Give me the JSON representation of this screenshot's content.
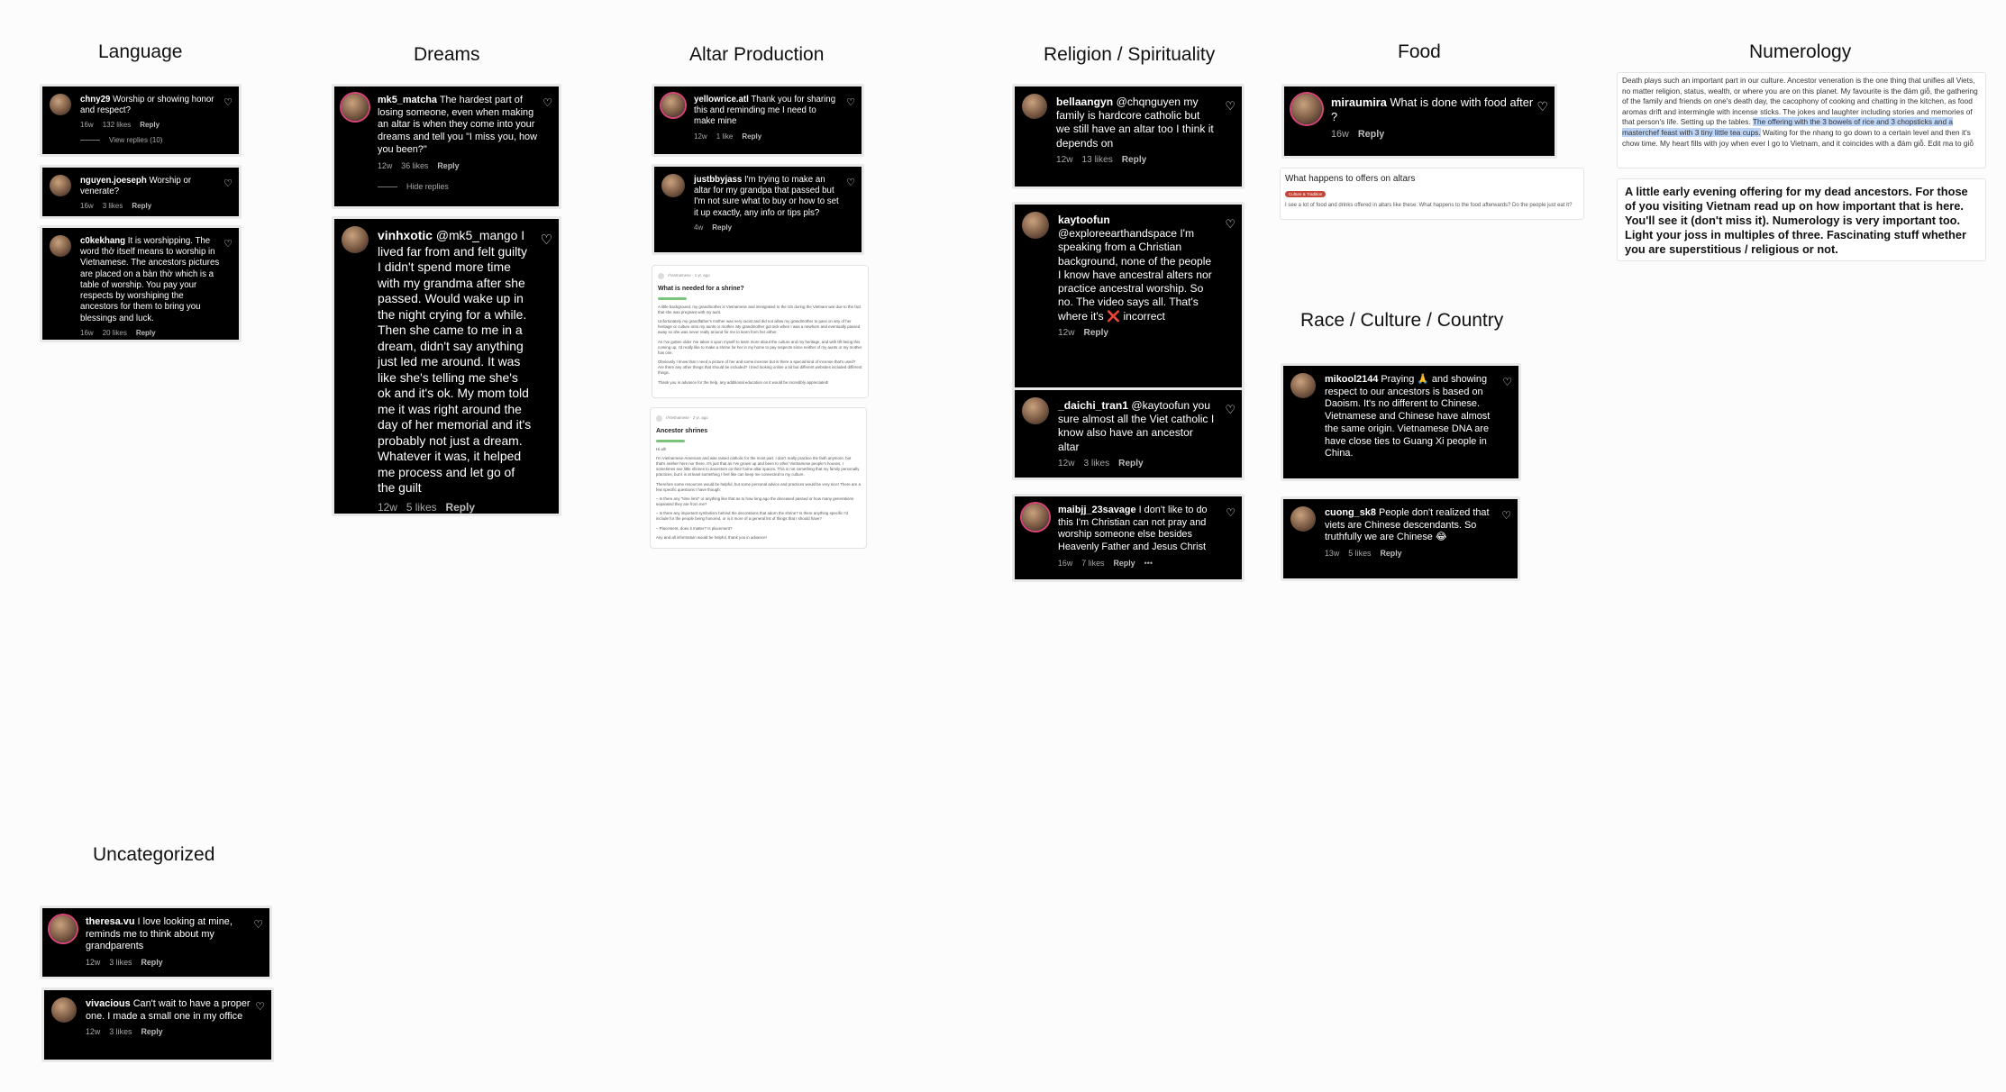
{
  "headings": {
    "language": "Language",
    "dreams": "Dreams",
    "altar": "Altar Production",
    "religion": "Religion / Spirituality",
    "food": "Food",
    "numerology": "Numerology",
    "race": "Race / Culture / Country",
    "uncategorized": "Uncategorized"
  },
  "comments": {
    "lang1": {
      "user": "chny29",
      "text": "Worship or showing honor and respect?",
      "time": "16w",
      "likes": "132 likes",
      "reply": "Reply",
      "extra": "View replies (10)"
    },
    "lang2": {
      "user": "nguyen.joeseph",
      "text": "Worship or venerate?",
      "time": "16w",
      "likes": "3 likes",
      "reply": "Reply"
    },
    "lang3": {
      "user": "c0kekhang",
      "text": "It is worshipping. The word thờ itself means to worship in Vietnamese. The ancestors pictures are placed on a bàn thờ which is a table of worship. You pay your respects by worshiping the ancestors for them to bring you blessings and luck.",
      "time": "16w",
      "likes": "20 likes",
      "reply": "Reply"
    },
    "dream1": {
      "user": "mk5_matcha",
      "text": "The hardest part of losing someone, even when making an altar is when they come into your dreams and tell you \"I miss you, how you been?\"",
      "time": "12w",
      "likes": "36 likes",
      "reply": "Reply",
      "extra": "Hide replies"
    },
    "dream2": {
      "user": "vinhxotic",
      "text": "@mk5_mango I lived far from and felt guilty I didn't spend more time with my grandma after she passed. Would wake up in the night crying for a while. Then she came to me in a dream, didn't say anything just led me around. It was like she's telling me she's ok and it's ok. My mom told me it was right around the day of her memorial and it's probably not just a dream. Whatever it was, it helped me process and let go of the guilt",
      "time": "12w",
      "likes": "5 likes",
      "reply": "Reply"
    },
    "altar1": {
      "user": "yellowrice.atl",
      "text": "Thank you for sharing this and reminding me I need to make mine",
      "time": "12w",
      "likes": "1 like",
      "reply": "Reply"
    },
    "altar2": {
      "user": "justbbyjass",
      "text": "I'm trying to make an altar for my grandpa that passed but I'm not sure what to buy or how to set it up exactly, any info or tips pls?",
      "time": "4w",
      "likes": "",
      "reply": "Reply"
    },
    "rel1": {
      "user": "bellaangyn",
      "text": "@chqnguyen my family is hardcore catholic but we still have an altar too I think it depends on",
      "time": "12w",
      "likes": "13 likes",
      "reply": "Reply"
    },
    "rel2": {
      "user": "kaytoofun",
      "text": "@exploreearthandspace I'm speaking from a Christian background, none of the people I know have ancestral alters nor practice ancestral worship. So no. The video says all. That's where it's ❌ incorrect",
      "time": "12w",
      "likes": "",
      "reply": "Reply"
    },
    "rel3": {
      "user": "_daichi_tran1",
      "text": "@kaytoofun you sure almost all the Viet catholic I know also have an ancestor altar",
      "time": "12w",
      "likes": "3 likes",
      "reply": "Reply"
    },
    "rel4": {
      "user": "maibjj_23savage",
      "text": "I don't like to do this I'm Christian can not pray and worship someone else besides Heavenly Father and Jesus Christ",
      "time": "16w",
      "likes": "7 likes",
      "reply": "Reply",
      "extra": "•••"
    },
    "food1": {
      "user": "miraumira",
      "text": "What is done with food after ?",
      "time": "16w",
      "likes": "",
      "reply": "Reply"
    },
    "race1": {
      "user": "mikool2144",
      "text": "Praying 🙏 and showing respect to our ancestors is based on Daoism. It's no different to Chinese. Vietnamese and Chinese have almost the same origin. Vietnamese DNA are have close ties to Guang Xi people in China.",
      "time": "",
      "likes": "",
      "reply": ""
    },
    "race2": {
      "user": "cuong_sk8",
      "text": "People don't realized that viets are Chinese descendants. So truthfully we are Chinese 😂",
      "time": "13w",
      "likes": "5 likes",
      "reply": "Reply"
    },
    "unc1": {
      "user": "theresa.vu",
      "text": "I love looking at mine, reminds me to think about my grandparents",
      "time": "12w",
      "likes": "3 likes",
      "reply": "Reply"
    },
    "unc2": {
      "user": "vivacious",
      "text": "Can't wait to have a proper one. I made a small one in my office",
      "time": "12w",
      "likes": "3 likes",
      "reply": "Reply"
    }
  },
  "docs": {
    "shrine": {
      "author": "r/Vietnamese · 1 yr. ago",
      "title": "What is needed for a shrine?",
      "p1": "A little background, my grandmother is Vietnamese and immigrated to the US during the Vietnam war due to the fact that she was pregnant with my aunt.",
      "p2": "Unfortunately my grandfather's mother was very racist and did not allow my grandmother to pass on any of her heritage or culture onto my aunts or mother. My grandmother got sick when I was a newborn and eventually passed away so she was never really around for me to learn from her either.",
      "p3": "As I've gotten older I've taken it upon myself to learn more about the culture and my heritage, and with tết being this coming up, I'd really like to make a shrine for her in my home to pay respects since neither of my aunts or my mother has one.",
      "p4": "Obviously I know that I need a picture of her and some incense but is there a special kind of incense that's used? Are there any other things that should be included? I tried looking online a bit but different websites included different things.",
      "p5": "Thank you in advance for the help, any additional education on it would be incredibly appreciated!"
    },
    "ancestor": {
      "author": "r/Vietnamese · 2 yr. ago",
      "title": "Ancestor shrines",
      "p1": "Hi all!",
      "p2": "I'm Vietnamese-American and was raised catholic for the most part. I don't really practice the faith anymore, but that's neither here nor there. It's just that as I've grown up and been to other Vietnamese people's houses, I sometimes see little shrines to ancestors on their home altar spaces. This is not something that my family personally practices, but it is at least something I feel like can keep me connected to my culture.",
      "p3": "Therefore some resources would be helpful, but some personal advice and practices would be very nice! There are a few specific questions I have though:",
      "p4": "– Is there any \"time limit\" or anything like that as to how long ago the deceased passed or how many generations separated they are from me?",
      "p5": "– Is there any important symbolism behind the decorations that adorn the shrine? Is there anything specific I'd include for the people being honored, or is it more of a general list of things that I should have?",
      "p6": "– Placement, does it matter? Is placement?",
      "p7": "Any and all information would be helpful, thank you in advance!"
    }
  },
  "food_post": {
    "title": "What happens to offers on altars",
    "tag": "Culture & Tradition",
    "body": "I see a lot of food and drinks offered in altars like these. What happens to the food afterwards? Do the people just eat it?"
  },
  "numerology": {
    "note_before": "Death plays such an important part in our culture. Ancestor veneration is the one thing that unifies all Viets, no matter religion, status, wealth, or where you are on this planet. My favourite is the đám giỗ, the gathering of the family and friends on one's death day, the cacophony of cooking and chatting in the kitchen, as food aromas drift and intermingle with incense sticks. The jokes and laughter including stories and memories of that person's life. Setting up the tables. ",
    "note_highlight": "The offering with the 3 bowels of rice and 3 chopsticks and a masterchef feast with 3 tiny little tea cups.",
    "note_after": " Waiting for the nhang to go down to a certain level and then it's chow time. My heart fills with joy when ever I go to Vietnam, and it coincides with a đám giỗ. Edit ma to giỗ",
    "caption": "A little early evening offering for my dead ancestors. For those of you visiting Vietnam read up on how important that is here. You'll see it (don't miss it). Numerology is very important too. Light your joss in multiples of three. Fascinating stuff whether you are superstitious / religious or not."
  },
  "icons": {
    "heart": "heart-icon",
    "avatar": "avatar"
  }
}
